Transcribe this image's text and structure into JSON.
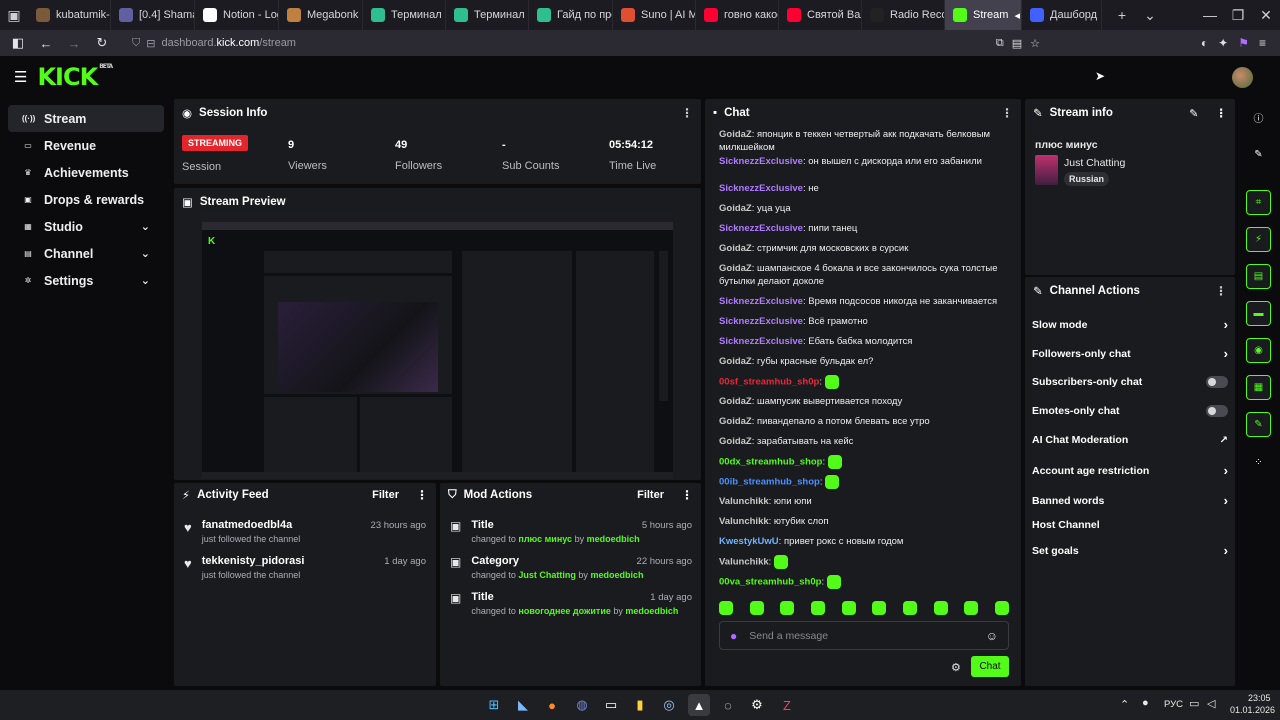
{
  "browser": {
    "tabs": [
      {
        "label": "kubatumik-lite",
        "icon": "game-icon",
        "color": "#7a5a3a"
      },
      {
        "label": "[0.4] Shaman B",
        "icon": "shield-icon",
        "color": "#6060a0"
      },
      {
        "label": "Notion - Log in",
        "icon": "notion-icon",
        "color": "#ffffff"
      },
      {
        "label": "Megabonk Lea",
        "icon": "game-icon",
        "color": "#c08040"
      },
      {
        "label": "Терминал | Esc",
        "icon": "terminal-icon",
        "color": "#2fbf8f"
      },
      {
        "label": "Терминал | Esc",
        "icon": "terminal-icon",
        "color": "#2fbf8f"
      },
      {
        "label": "Гайд по прохо",
        "icon": "guide-icon",
        "color": "#2fbf8f"
      },
      {
        "label": "Suno | AI Music",
        "icon": "suno-icon",
        "color": "#e05030"
      },
      {
        "label": "говно какое то",
        "icon": "youtube-icon",
        "color": "#ff0033"
      },
      {
        "label": "Святой Вален",
        "icon": "youtube-icon",
        "color": "#ff0033"
      },
      {
        "label": "Radio Record",
        "icon": "radio-icon",
        "color": "#222222"
      },
      {
        "label": "Stream",
        "icon": "kick-icon",
        "color": "#53fc18"
      },
      {
        "label": "Дашборд",
        "icon": "dashboard-icon",
        "color": "#4060ff"
      }
    ],
    "url_prefix": "dashboard.",
    "url_domain": "kick.com",
    "url_path": "/stream"
  },
  "header": {
    "logo": "KICK",
    "beta": "BETA"
  },
  "sidebar": {
    "items": [
      {
        "label": "Stream",
        "icon": "broadcast-icon",
        "has_chevron": false
      },
      {
        "label": "Revenue",
        "icon": "money-icon",
        "has_chevron": false
      },
      {
        "label": "Achievements",
        "icon": "trophy-icon",
        "has_chevron": false
      },
      {
        "label": "Drops & rewards",
        "icon": "gift-icon",
        "has_chevron": false
      },
      {
        "label": "Studio",
        "icon": "studio-icon",
        "has_chevron": true
      },
      {
        "label": "Channel",
        "icon": "channel-icon",
        "has_chevron": true
      },
      {
        "label": "Settings",
        "icon": "gear-icon",
        "has_chevron": true
      }
    ]
  },
  "session": {
    "title": "Session Info",
    "status": "STREAMING",
    "status_label": "Session",
    "viewers": "9",
    "viewers_label": "Viewers",
    "followers": "49",
    "followers_label": "Followers",
    "subs": "-",
    "subs_label": "Sub Counts",
    "time": "05:54:12",
    "time_label": "Time Live"
  },
  "preview": {
    "title": "Stream Preview"
  },
  "activity": {
    "title": "Activity Feed",
    "filter": "Filter",
    "items": [
      {
        "name": "fanatmedoedbl4a",
        "sub": "just followed the channel",
        "time": "23 hours ago"
      },
      {
        "name": "tekkenisty_pidorasi",
        "sub": "just followed the channel",
        "time": "1 day ago"
      }
    ]
  },
  "mod": {
    "title": "Mod Actions",
    "filter": "Filter",
    "items": [
      {
        "title": "Title",
        "time": "5 hours ago",
        "pre": "changed to",
        "val": "плюс минус",
        "by": "by",
        "user": "medoedbich"
      },
      {
        "title": "Category",
        "time": "22 hours ago",
        "pre": "changed to",
        "val": "Just Chatting",
        "by": "by",
        "user": "medoedbich"
      },
      {
        "title": "Title",
        "time": "1 day ago",
        "pre": "changed to",
        "val": "новогоднее дожитие",
        "by": "by",
        "user": "medoedbich"
      }
    ]
  },
  "chat": {
    "title": "Chat",
    "messages": [
      {
        "user": "GoidaZ",
        "color": "#c9c9c9",
        "text": "японцик в теккен четвертый акк подкачать белковым милкшейком"
      },
      {
        "user": "SicknezzExclusive",
        "color": "#b17cff",
        "text": "он вышел с дискорда или его забанили"
      },
      {
        "user": "SicknezzExclusive",
        "color": "#b17cff",
        "text": "не"
      },
      {
        "user": "GoidaZ",
        "color": "#c9c9c9",
        "text": "уца уца"
      },
      {
        "user": "SicknezzExclusive",
        "color": "#b17cff",
        "text": "пипи танец"
      },
      {
        "user": "GoidaZ",
        "color": "#c9c9c9",
        "text": "стримчик для московских в сурсик"
      },
      {
        "user": "GoidaZ",
        "color": "#c9c9c9",
        "text": "шампанское 4 бокала и все закончилось сука толстые бутылки делают доколе"
      },
      {
        "user": "SicknezzExclusive",
        "color": "#b17cff",
        "text": "Время подсосов никогда не заканчивается"
      },
      {
        "user": "SicknezzExclusive",
        "color": "#b17cff",
        "text": "Всё грамотно"
      },
      {
        "user": "SicknezzExclusive",
        "color": "#b17cff",
        "text": "Ебать бабка молодится"
      },
      {
        "user": "GoidaZ",
        "color": "#c9c9c9",
        "text": "губы красные бульдак ел?"
      },
      {
        "user": "00sf_streamhub_sh0p",
        "color": "#e8283a",
        "text": "",
        "emote": true
      },
      {
        "user": "GoidaZ",
        "color": "#c9c9c9",
        "text": "шампусик вывертивается походу"
      },
      {
        "user": "GoidaZ",
        "color": "#c9c9c9",
        "text": "пивандепало а потом блевать все утро"
      },
      {
        "user": "GoidaZ",
        "color": "#c9c9c9",
        "text": "зарабатывать на кейс"
      },
      {
        "user": "00dx_streamhub_shop",
        "color": "#53fc18",
        "text": "",
        "emote": true
      },
      {
        "user": "00ib_streamhub_shop",
        "color": "#4a90ff",
        "text": "",
        "emote": true
      },
      {
        "user": "Valunchikk",
        "color": "#c9c9c9",
        "text": "юпи юпи"
      },
      {
        "user": "Valunchikk",
        "color": "#c9c9c9",
        "text": "ютубик слоп"
      },
      {
        "user": "KwestykUwU",
        "color": "#6fb4ff",
        "text": "привет рокс с новым годом"
      },
      {
        "user": "Valunchikk",
        "color": "#c9c9c9",
        "text": "",
        "emote": true
      },
      {
        "user": "00va_streamhub_sh0p",
        "color": "#53fc18",
        "text": "",
        "emote": true
      }
    ],
    "input_placeholder": "Send a message",
    "send_label": "Chat"
  },
  "streaminfo": {
    "title": "Stream info",
    "stream_title": "плюс минус",
    "category": "Just Chatting",
    "tag": "Russian"
  },
  "actions": {
    "title": "Channel Actions",
    "items": [
      {
        "label": "Slow mode",
        "kind": "arrow"
      },
      {
        "label": "Followers-only chat",
        "kind": "arrow"
      },
      {
        "label": "Subscribers-only chat",
        "kind": "toggle"
      },
      {
        "label": "Emotes-only chat",
        "kind": "toggle"
      },
      {
        "label": "AI Chat Moderation",
        "kind": "external"
      },
      {
        "label": "Account age restriction",
        "kind": "arrow"
      },
      {
        "label": "Banned words",
        "kind": "arrow"
      },
      {
        "label": "Host Channel",
        "kind": "none"
      },
      {
        "label": "Set goals",
        "kind": "arrow"
      }
    ]
  },
  "taskbar": {
    "lang": "РУС",
    "time": "23:05",
    "date": "01.01.2026"
  }
}
